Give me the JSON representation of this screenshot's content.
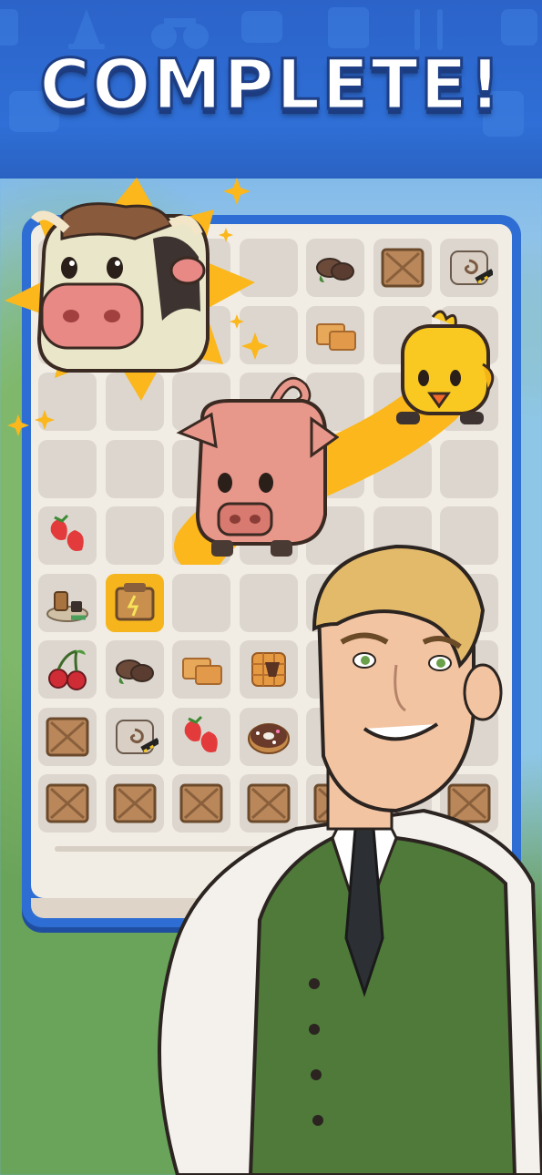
{
  "title": "COMPLETE!",
  "colors": {
    "banner": "#2f6fd6",
    "board_frame": "#2e6ed4",
    "board": "#f1ece4",
    "cell": "#dcd6cf",
    "highlight": "#f7b51d"
  },
  "featured_animals": [
    "cow",
    "pig",
    "chick"
  ],
  "board_items": [
    {
      "row": 0,
      "col": 4,
      "icon": "coffee-beans-icon"
    },
    {
      "row": 0,
      "col": 5,
      "icon": "wooden-crate-icon"
    },
    {
      "row": 0,
      "col": 6,
      "icon": "cinnamon-roll-locked-icon"
    },
    {
      "row": 1,
      "col": 4,
      "icon": "crackers-icon"
    },
    {
      "row": 4,
      "col": 0,
      "icon": "strawberries-icon"
    },
    {
      "row": 5,
      "col": 0,
      "icon": "coffee-set-icon"
    },
    {
      "row": 5,
      "col": 1,
      "icon": "coffee-machine-icon"
    },
    {
      "row": 6,
      "col": 0,
      "icon": "cherries-icon"
    },
    {
      "row": 6,
      "col": 1,
      "icon": "coffee-beans-icon"
    },
    {
      "row": 6,
      "col": 2,
      "icon": "crackers-icon"
    },
    {
      "row": 6,
      "col": 3,
      "icon": "waffle-icon"
    },
    {
      "row": 7,
      "col": 0,
      "icon": "wooden-crate-icon"
    },
    {
      "row": 7,
      "col": 1,
      "icon": "cinnamon-roll-locked-icon"
    },
    {
      "row": 7,
      "col": 2,
      "icon": "strawberries-icon"
    },
    {
      "row": 7,
      "col": 3,
      "icon": "donut-icon"
    },
    {
      "row": 8,
      "col": 0,
      "icon": "wooden-crate-icon"
    },
    {
      "row": 8,
      "col": 1,
      "icon": "wooden-crate-icon"
    },
    {
      "row": 8,
      "col": 2,
      "icon": "wooden-crate-icon"
    },
    {
      "row": 8,
      "col": 3,
      "icon": "wooden-crate-icon"
    },
    {
      "row": 8,
      "col": 4,
      "icon": "wooden-crate-icon"
    },
    {
      "row": 8,
      "col": 6,
      "icon": "wooden-crate-icon"
    }
  ]
}
